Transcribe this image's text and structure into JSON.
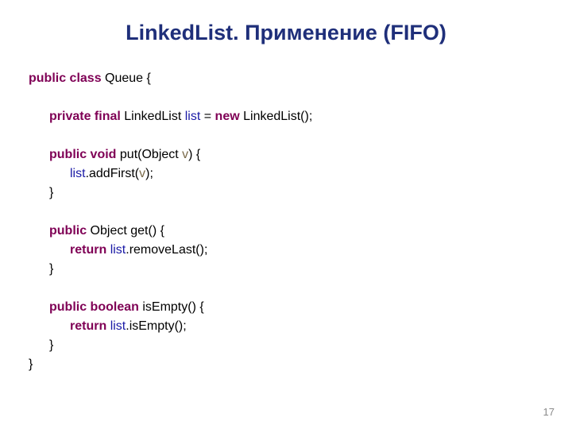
{
  "title": "LinkedList. Применение (FIFO)",
  "pagenum": "17",
  "kw": {
    "publicClass": "public class",
    "privateFinal": "private final",
    "publicVoid": "public void",
    "public": "public",
    "publicBoolean": "public boolean",
    "new": "new",
    "return": "return"
  },
  "sym": {
    "list": "list",
    "v": "v"
  },
  "txt": {
    "queueOpen": " Queue {",
    "linkedlistDecl": " LinkedList ",
    "eq": " = ",
    "linkedlistCtor": " LinkedList();",
    "putOpen": " put(Object ",
    "putClose": ") {",
    "addFirstOpen": ".addFirst(",
    "addFirstClose": ");",
    "closeBrace": "}",
    "getOpen": " Object get() {",
    "removeLast": ".removeLast();",
    "isEmptyOpen": " isEmpty() {",
    "isEmptyCall": ".isEmpty();",
    "sp": " "
  }
}
